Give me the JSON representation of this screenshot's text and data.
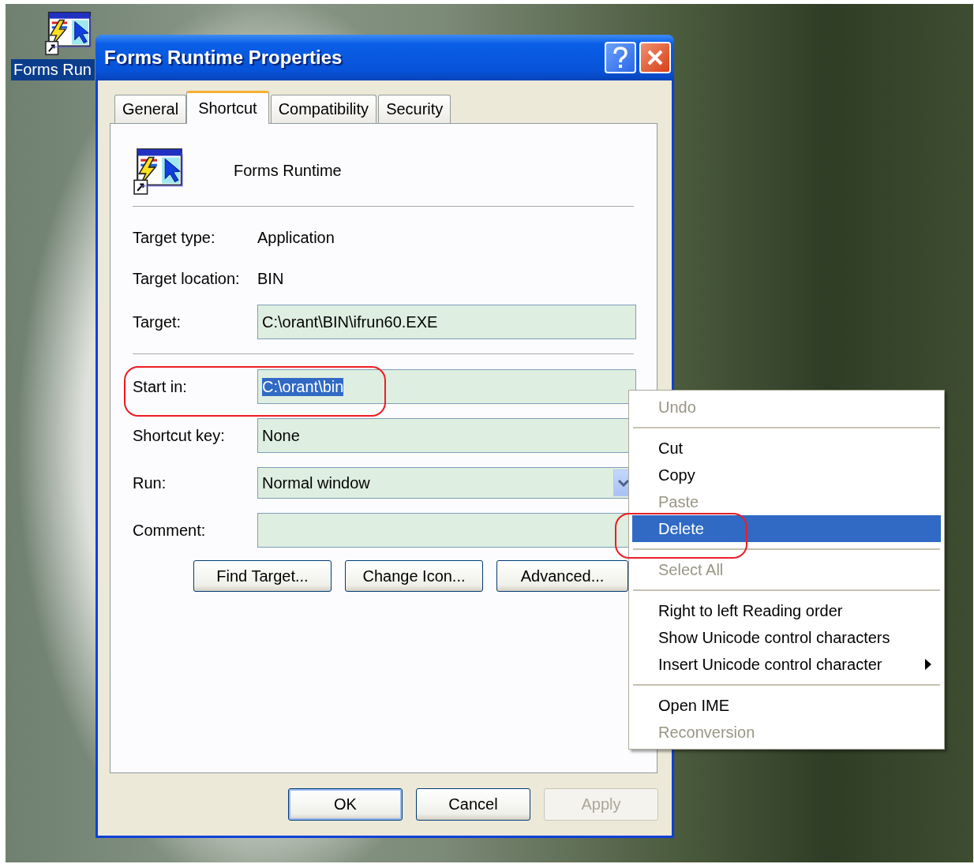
{
  "desktop": {
    "icon_label": "Forms Run",
    "icon_selected": true
  },
  "window": {
    "title": "Forms Runtime Properties"
  },
  "tabs": [
    {
      "label": "General",
      "selected": false
    },
    {
      "label": "Shortcut",
      "selected": true
    },
    {
      "label": "Compatibility",
      "selected": false
    },
    {
      "label": "Security",
      "selected": false
    }
  ],
  "shortcut_name": "Forms Runtime",
  "info": [
    {
      "label": "Target type:",
      "value": "Application"
    },
    {
      "label": "Target location:",
      "value": "BIN"
    }
  ],
  "fields": [
    {
      "kind": "text",
      "label": "Target:",
      "value": "C:\\orant\\BIN\\ifrun60.EXE",
      "text_selected": false
    },
    {
      "kind": "separator"
    },
    {
      "kind": "text",
      "label": "Start in:",
      "value": "C:\\orant\\bin",
      "text_selected": true
    },
    {
      "kind": "text",
      "label": "Shortcut key:",
      "value": "None",
      "text_selected": false
    },
    {
      "kind": "dropdown",
      "label": "Run:",
      "value": "Normal window",
      "text_selected": false
    },
    {
      "kind": "text",
      "label": "Comment:",
      "text_selected": false
    }
  ],
  "action_buttons": [
    "Find Target...",
    "Change Icon...",
    "Advanced..."
  ],
  "dialog_buttons": [
    {
      "label": "OK",
      "default": true,
      "disabled": false
    },
    {
      "label": "Cancel",
      "default": false,
      "disabled": false
    },
    {
      "label": "Apply",
      "default": false,
      "disabled": true
    }
  ],
  "context_menu": {
    "items": [
      {
        "kind": "item",
        "label": "Undo",
        "disabled": true,
        "selected": false,
        "submenu": false
      },
      {
        "kind": "separator"
      },
      {
        "kind": "item",
        "label": "Cut",
        "disabled": false,
        "selected": false,
        "submenu": false
      },
      {
        "kind": "item",
        "label": "Copy",
        "disabled": false,
        "selected": false,
        "submenu": false
      },
      {
        "kind": "item",
        "label": "Paste",
        "disabled": true,
        "selected": false,
        "submenu": false
      },
      {
        "kind": "item",
        "label": "Delete",
        "disabled": false,
        "selected": true,
        "submenu": false
      },
      {
        "kind": "separator"
      },
      {
        "kind": "item",
        "label": "Select All",
        "disabled": true,
        "selected": false,
        "submenu": false
      },
      {
        "kind": "separator"
      },
      {
        "kind": "item",
        "label": "Right to left Reading order",
        "disabled": false,
        "selected": false,
        "submenu": false
      },
      {
        "kind": "item",
        "label": "Show Unicode control characters",
        "disabled": false,
        "selected": false,
        "submenu": false
      },
      {
        "kind": "item",
        "label": "Insert Unicode control character",
        "disabled": false,
        "selected": false,
        "submenu": true
      },
      {
        "kind": "separator"
      },
      {
        "kind": "item",
        "label": "Open IME",
        "disabled": false,
        "selected": false,
        "submenu": false
      },
      {
        "kind": "item",
        "label": "Reconversion",
        "disabled": true,
        "selected": false,
        "submenu": false
      }
    ]
  }
}
